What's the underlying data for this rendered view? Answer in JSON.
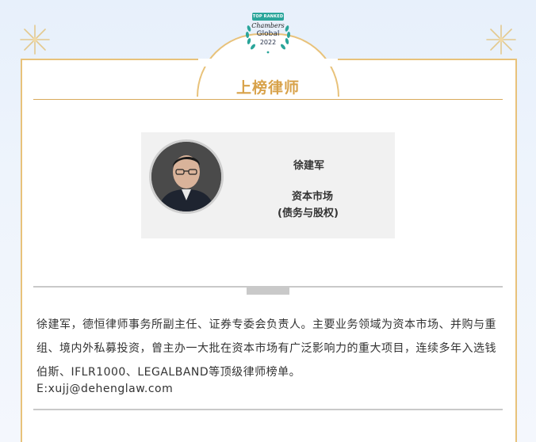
{
  "badge": {
    "top_ranked": "TOP RANKED",
    "brand": "Chambers",
    "edition": "Global",
    "year": "2022"
  },
  "section": {
    "title": "上榜律师"
  },
  "lawyer": {
    "name": "徐建军",
    "practice_line1": "资本市场",
    "practice_line2": "(债务与股权)"
  },
  "bio": {
    "text": "徐建军，德恒律师事务所副主任、证券专委会负责人。主要业务领域为资本市场、并购与重组、境内外私募投资，曾主办一大批在资本市场有广泛影响力的重大项目，连续多年入选钱伯斯、IFLR1000、LEGALBAND等顶级律师榜单。",
    "email": "E:xujj@dehenglaw.com"
  },
  "colors": {
    "gold": "#d8a24a",
    "badge_green": "#2aa59a",
    "background": "#e7f0fb"
  }
}
